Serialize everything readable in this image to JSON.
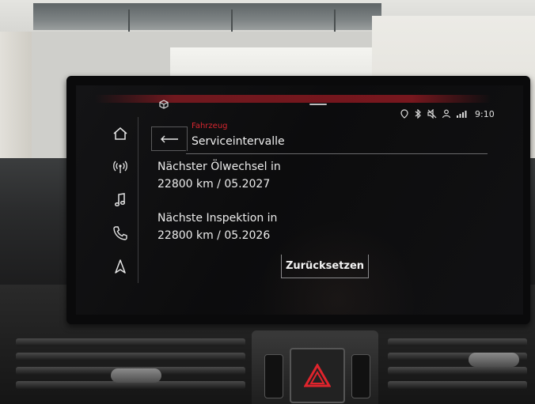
{
  "status_bar": {
    "time": "9:10",
    "icons": [
      "navigation-pin-icon",
      "bluetooth-icon",
      "mute-icon",
      "person-icon",
      "signal-icon"
    ]
  },
  "sidebar": {
    "items": [
      {
        "icon": "home-icon"
      },
      {
        "icon": "radio-icon"
      },
      {
        "icon": "music-note-icon"
      },
      {
        "icon": "phone-icon"
      },
      {
        "icon": "navigation-arrow-icon"
      }
    ]
  },
  "header": {
    "breadcrumb": "Fahrzeug",
    "title": "Serviceintervalle"
  },
  "main": {
    "oil_change_label": "Nächster Ölwechsel in",
    "oil_change_value": "22800 km / 05.2027",
    "inspection_label": "Nächste Inspektion in",
    "inspection_value": "22800 km / 05.2026",
    "reset_button_label": "Zurücksetzen"
  },
  "colors": {
    "accent_red": "#d8262f",
    "hazard_red": "#e0242c",
    "text": "#ececec",
    "screen_bg": "#0e0e0f"
  }
}
